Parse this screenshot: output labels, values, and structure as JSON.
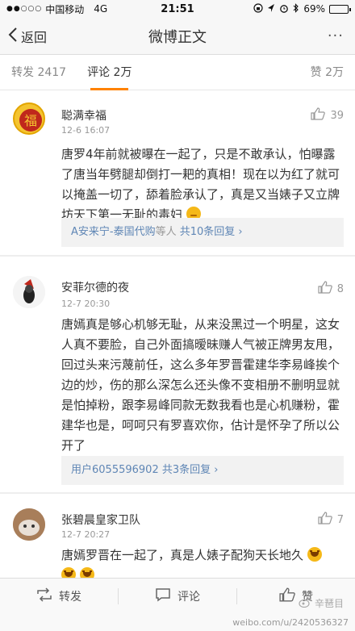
{
  "status_bar": {
    "signal": "●●○○○",
    "carrier": "中国移动",
    "network": "4G",
    "time": "21:51",
    "battery": "69%",
    "battery_level": 0.69
  },
  "nav": {
    "back_label": "返回",
    "title": "微博正文",
    "more": "···"
  },
  "tabs": [
    {
      "label": "转发 2417"
    },
    {
      "label": "评论 2万"
    },
    {
      "label": "赞 2万"
    }
  ],
  "comments": [
    {
      "name": "聪满幸福",
      "time": "12-6 16:07",
      "likes": "39",
      "text": "唐罗4年前就被曝在一起了，只是不敢承认，怕曝露了唐当年劈腿却倒打一耙的真相！现在以为红了就可以掩盖一切了，舔着脸承认了，真是又当婊子又立牌坊天下第一无耻的毒妇",
      "reply_user": "A安来宁-泰国代购",
      "reply_mid": "等人",
      "reply_count": "共10条回复"
    },
    {
      "name": "安菲尔德的夜",
      "time": "12-7 20:30",
      "likes": "8",
      "text": "唐嫣真是够心机够无耻，从来没黑过一个明星，这女人真不要脸，自己外面搞暧昧赚人气被正牌男友甩，回过头来污蔑前任，这么多年罗晋霍建华李易峰挨个边的炒，伤的那么深怎么还头像不变相册不删明显就是怕掉粉，跟李易峰同款无数我看也是心机赚粉，霍建华也是，呵呵只有罗喜欢你，估计是怀孕了所以公开了",
      "reply_user": "用户6055596902",
      "reply_mid": "",
      "reply_count": "共3条回复"
    },
    {
      "name": "张碧晨皇家卫队",
      "time": "12-7 20:27",
      "likes": "7",
      "text": "唐嫣罗晋在一起了，真是人婊子配狗天长地久"
    }
  ],
  "actions": {
    "repost": "转发",
    "comment": "评论",
    "like": "赞"
  },
  "watermark": {
    "logo_text": "辛琶目",
    "url": "weibo.com/u/2420536327"
  },
  "colors": {
    "accent": "#ff8200",
    "link": "#5f86b5"
  }
}
